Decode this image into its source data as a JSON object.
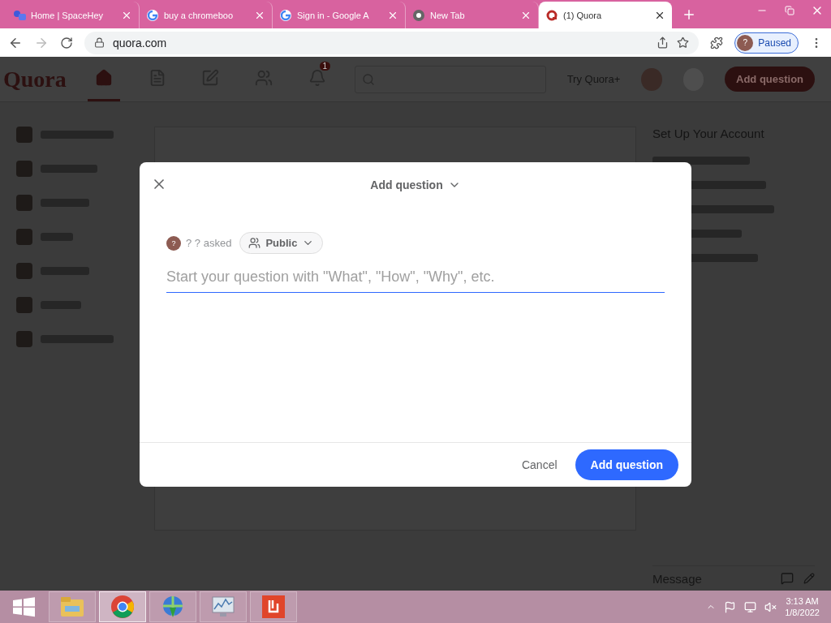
{
  "tabs": [
    {
      "kind": "spacehey",
      "title": "Home | SpaceHey",
      "selected": false
    },
    {
      "kind": "google",
      "title": "buy a chromeboo",
      "selected": false
    },
    {
      "kind": "google",
      "title": "Sign in - Google A",
      "selected": false
    },
    {
      "kind": "chrome",
      "title": "New Tab",
      "selected": false
    },
    {
      "kind": "quora",
      "title": "(1) Quora",
      "selected": true
    }
  ],
  "address_bar": {
    "url": "quora.com"
  },
  "profile": {
    "avatar": "?",
    "label": "Paused"
  },
  "page": {
    "logo": "Quora",
    "nav": [
      {
        "kind": "home",
        "selected": true
      },
      {
        "kind": "list",
        "selected": false
      },
      {
        "kind": "edit",
        "selected": false
      },
      {
        "kind": "people",
        "selected": false
      },
      {
        "kind": "bell",
        "selected": false,
        "badge": "1"
      }
    ],
    "try_plus": "Try Quora+",
    "add_question_button": "Add question",
    "right_panel_title": "Set Up Your Account",
    "message_label": "Message"
  },
  "dialog": {
    "title": "Add question",
    "asker_avatar": "?",
    "asked_text": "? ? asked",
    "audience": "Public",
    "placeholder": "Start your question with \"What\", \"How\", \"Why\", etc.",
    "cancel": "Cancel",
    "submit": "Add question"
  },
  "taskbar": {
    "apps": [
      {
        "kind": "explorer",
        "selected": false
      },
      {
        "kind": "chrome",
        "selected": true
      },
      {
        "kind": "download",
        "selected": false
      },
      {
        "kind": "monitor",
        "selected": false
      },
      {
        "kind": "red-app",
        "selected": false
      }
    ],
    "time": "3:13 AM",
    "date": "1/8/2022"
  }
}
